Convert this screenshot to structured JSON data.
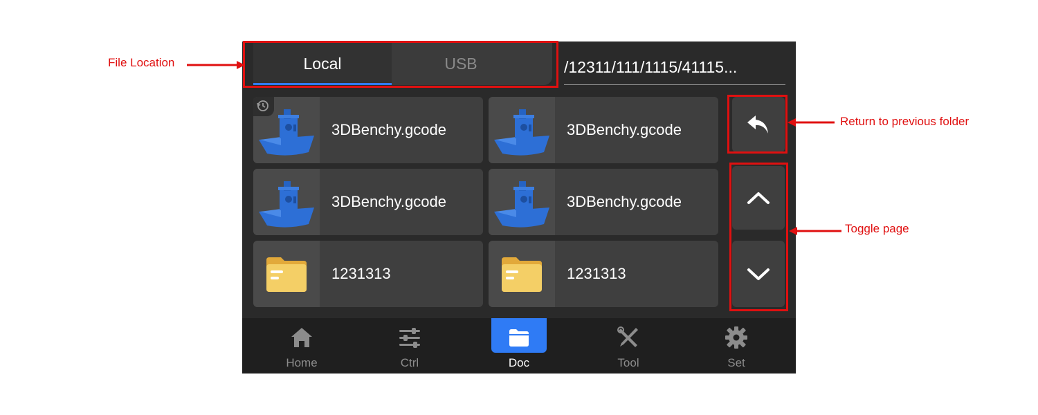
{
  "tabs": {
    "local": "Local",
    "usb": "USB"
  },
  "path": "/12311/111/1115/41115...",
  "files": [
    {
      "name": "3DBenchy.gcode",
      "type": "gcode",
      "recent": true
    },
    {
      "name": "3DBenchy.gcode",
      "type": "gcode",
      "recent": false
    },
    {
      "name": "3DBenchy.gcode",
      "type": "gcode",
      "recent": false
    },
    {
      "name": "3DBenchy.gcode",
      "type": "gcode",
      "recent": false
    },
    {
      "name": "1231313",
      "type": "folder",
      "recent": false
    },
    {
      "name": "1231313",
      "type": "folder",
      "recent": false
    }
  ],
  "nav": [
    {
      "label": "Home",
      "icon": "home-icon"
    },
    {
      "label": "Ctrl",
      "icon": "sliders-icon"
    },
    {
      "label": "Doc",
      "icon": "folder-icon",
      "active": true
    },
    {
      "label": "Tool",
      "icon": "tools-icon"
    },
    {
      "label": "Set",
      "icon": "gear-icon"
    }
  ],
  "annotations": {
    "file_location": "File Location",
    "return": "Return to previous folder",
    "toggle": "Toggle page"
  },
  "colors": {
    "accent": "#2f7bf5",
    "annotation": "#e01010",
    "folder": "#f2c85b",
    "boat": "#2d6fd6"
  }
}
